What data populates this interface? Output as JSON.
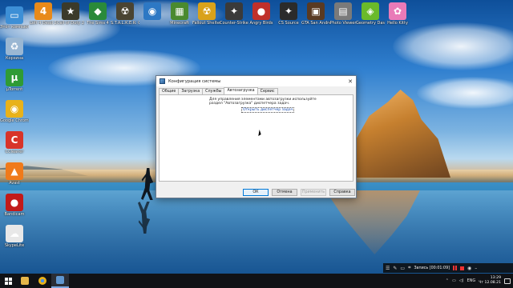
{
  "desktop": {
    "icons_top": [
      {
        "label": "Left 4 Dead 2",
        "icon": "left4dead-icon",
        "color": "#e88a1a",
        "glyph": "4"
      },
      {
        "label": "Call of Duty 2",
        "icon": "cod2-icon",
        "color": "#3b3a2a",
        "glyph": "★"
      },
      {
        "label": "The Sims 4",
        "icon": "sims-icon",
        "color": "#2a8a3a",
        "glyph": "◆"
      },
      {
        "label": "S.T.A.L.K.E.R. Call of Pripyat",
        "icon": "stalker-icon",
        "color": "#4a4432",
        "glyph": "☢"
      },
      {
        "label": "",
        "icon": "globe-app-icon",
        "color": "#2d78c4",
        "glyph": "◉"
      },
      {
        "label": "Minecraft",
        "icon": "minecraft-icon",
        "color": "#4a8a2f",
        "glyph": "▦"
      },
      {
        "label": "Fallout Shelter",
        "icon": "fallout-icon",
        "color": "#d9a21a",
        "glyph": "☢"
      },
      {
        "label": "Counter-Strike 1.6",
        "icon": "counter-strike-icon",
        "color": "#3a3a3a",
        "glyph": "✦"
      },
      {
        "label": "Angry Birds",
        "icon": "angry-birds-icon",
        "color": "#c0302a",
        "glyph": "●"
      },
      {
        "label": "CS Source",
        "icon": "cs-source-icon",
        "color": "#2b2b2b",
        "glyph": "✦"
      },
      {
        "label": "GTA San Andreas",
        "icon": "gta-icon",
        "color": "#5a3a22",
        "glyph": "▣"
      },
      {
        "label": "Photo Viewer",
        "icon": "photo-viewer-icon",
        "color": "#7a7a7a",
        "glyph": "▤"
      },
      {
        "label": "Geometry Dash",
        "icon": "geometry-dash-icon",
        "color": "#6aba2a",
        "glyph": "◈"
      },
      {
        "label": "Hello Kitty",
        "icon": "game-icon",
        "color": "#e97ab8",
        "glyph": "✿"
      }
    ],
    "icons_left": [
      {
        "label": "Этот компьютер",
        "icon": "this-pc-icon",
        "color": "#3d8fd6",
        "glyph": "▭"
      },
      {
        "label": "Корзина",
        "icon": "recycle-bin-icon",
        "color": "#9ab7d3",
        "glyph": "♻"
      },
      {
        "label": "µTorrent",
        "icon": "utorrent-icon",
        "color": "#2f9b35",
        "glyph": "µ"
      },
      {
        "label": "Google Chrome",
        "icon": "chrome-icon",
        "color": "#e8b21a",
        "glyph": "◉"
      },
      {
        "label": "CCleaner",
        "icon": "ccleaner-icon",
        "color": "#d8342a",
        "glyph": "C"
      },
      {
        "label": "Avast",
        "icon": "avast-icon",
        "color": "#f07a1a",
        "glyph": "▲"
      },
      {
        "label": "Bandicam",
        "icon": "bandicam-icon",
        "color": "#c21a1a",
        "glyph": "●"
      },
      {
        "label": "SkypeLite",
        "icon": "skype-icon",
        "color": "#e8e8e8",
        "glyph": "☁"
      }
    ]
  },
  "window": {
    "title": "Конфигурация системы",
    "tabs": [
      "Общие",
      "Загрузка",
      "Службы",
      "Автозагрузка",
      "Сервис"
    ],
    "active_tab": 3,
    "message": "Для управления элементами автозагрузки используйте раздел \"Автозагрузка\" диспетчера задач.",
    "link": "Открыть диспетчер задач",
    "buttons": {
      "ok": "ОК",
      "cancel": "Отмена",
      "apply": "Применить",
      "help": "Справка"
    }
  },
  "recorder": {
    "label": "Запись [00:01:09]"
  },
  "taskbar": {
    "apps": [
      {
        "name": "file-explorer-icon",
        "color": "#e5b64a"
      },
      {
        "name": "chrome-icon",
        "color": "#e8b21a"
      },
      {
        "name": "system-config-icon",
        "color": "#5f96cf"
      }
    ],
    "language": "ENG",
    "time": "13:29",
    "date": "Чт 12.08.21"
  }
}
